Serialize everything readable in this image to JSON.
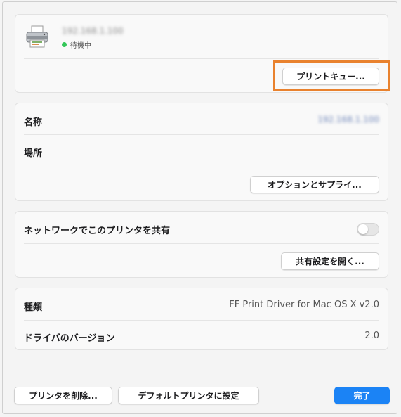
{
  "printer": {
    "name": "192.168.1.100",
    "status": "待機中",
    "status_color": "#34c759",
    "queue_button": "プリントキュー..."
  },
  "info": {
    "name_label": "名称",
    "name_value": "192.168.1.100",
    "location_label": "場所",
    "location_value": "",
    "options_button": "オプションとサプライ..."
  },
  "sharing": {
    "label": "ネットワークでこのプリンタを共有",
    "enabled": false,
    "settings_button": "共有設定を開く..."
  },
  "driver": {
    "kind_label": "種類",
    "kind_value": "FF Print Driver for Mac OS X v2.0",
    "version_label": "ドライバのバージョン",
    "version_value": "2.0"
  },
  "footer": {
    "delete_button": "プリンタを削除...",
    "default_button": "デフォルトプリンタに設定",
    "done_button": "完了"
  },
  "colors": {
    "accent": "#1b83f5",
    "highlight": "#e9822e"
  }
}
